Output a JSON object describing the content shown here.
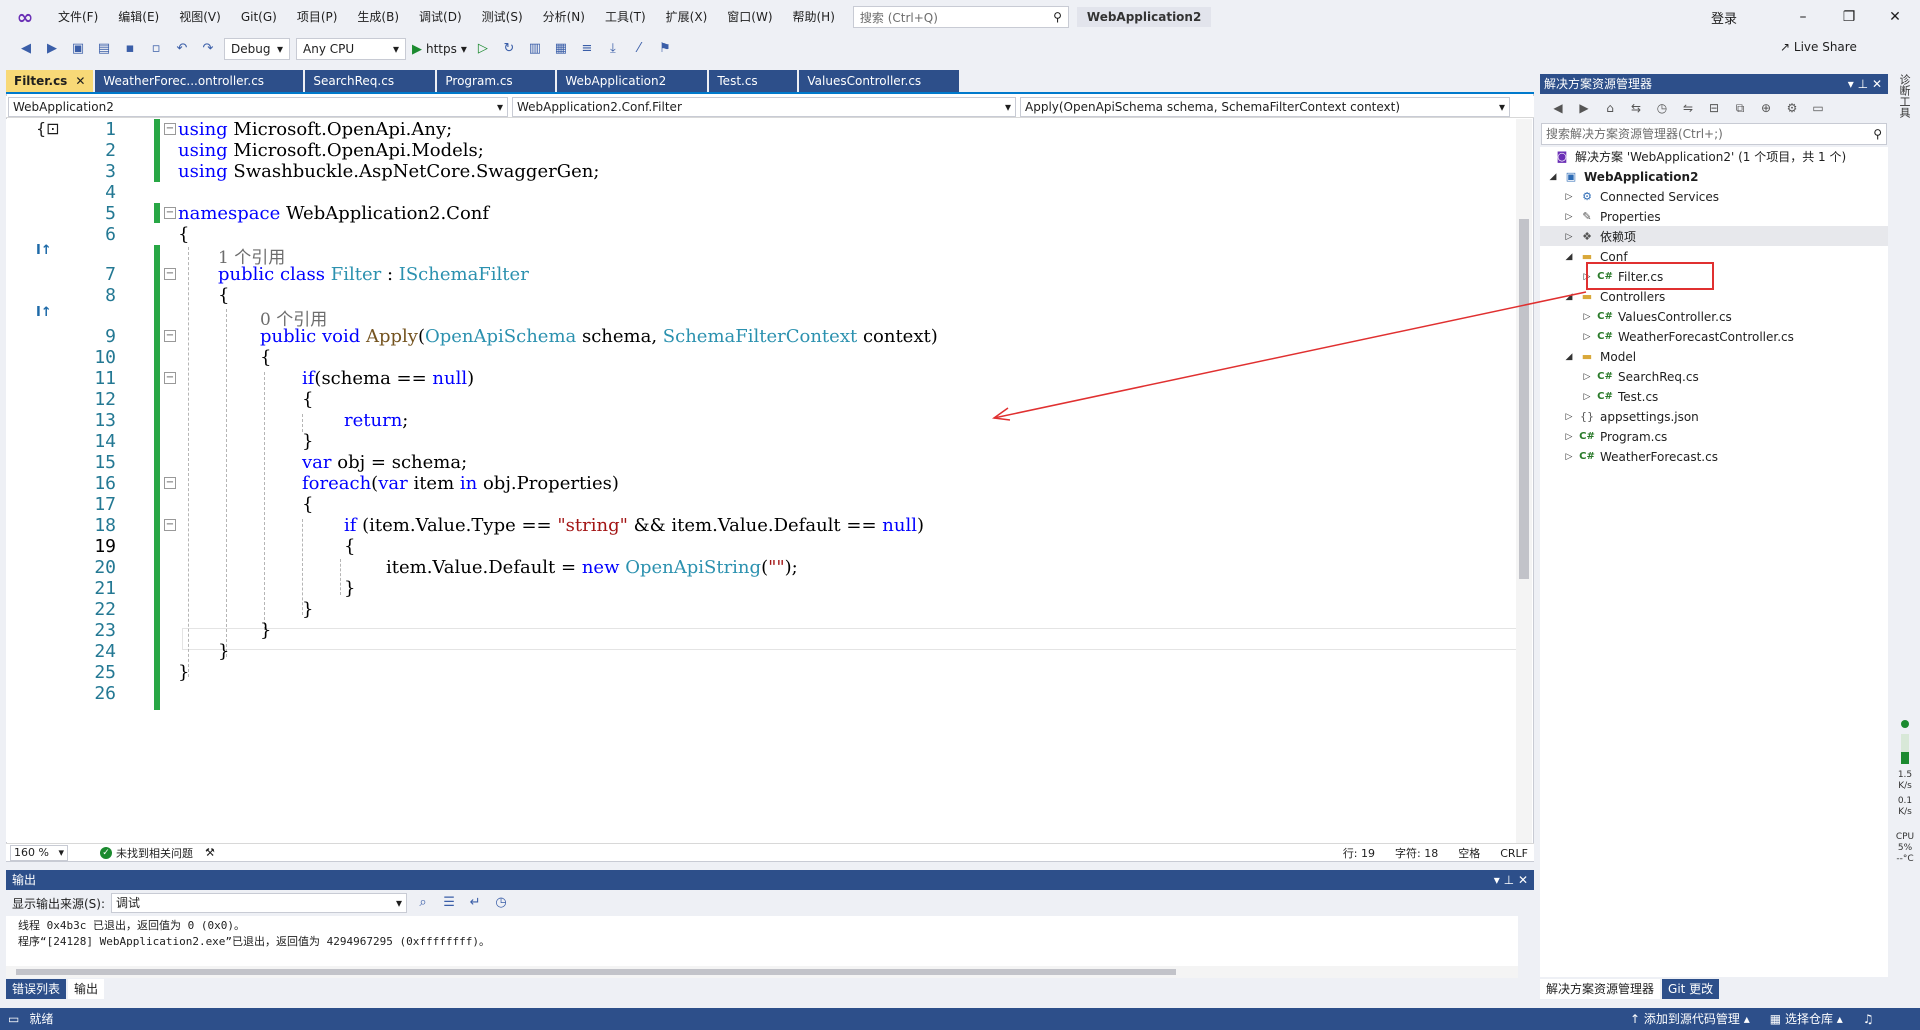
{
  "menu": {
    "items": [
      "文件(F)",
      "编辑(E)",
      "视图(V)",
      "Git(G)",
      "项目(P)",
      "生成(B)",
      "调试(D)",
      "测试(S)",
      "分析(N)",
      "工具(T)",
      "扩展(X)",
      "窗口(W)",
      "帮助(H)"
    ],
    "search_placeholder": "搜索 (Ctrl+Q)",
    "solution_name": "WebApplication2",
    "login": "登录"
  },
  "toolbar": {
    "config": "Debug",
    "platform": "Any CPU",
    "run_label": "https",
    "live_share": "Live Share"
  },
  "tabs": [
    "Filter.cs",
    "WeatherForec...ontroller.cs",
    "SearchReq.cs",
    "Program.cs",
    "WebApplication2",
    "Test.cs",
    "ValuesController.cs"
  ],
  "navbar": {
    "project": "WebApplication2",
    "class": "WebApplication2.Conf.Filter",
    "member": "Apply(OpenApiSchema schema, SchemaFilterContext context)"
  },
  "code": {
    "line_numbers": [
      "1",
      "2",
      "3",
      "4",
      "5",
      "6",
      "7",
      "8",
      "9",
      "10",
      "11",
      "12",
      "13",
      "14",
      "15",
      "16",
      "17",
      "18",
      "19",
      "20",
      "21",
      "22",
      "23",
      "24",
      "25",
      "26"
    ],
    "l1_kw": "using",
    "l1_rest": " Microsoft.OpenApi.Any;",
    "l2_kw": "using",
    "l2_rest": " Microsoft.OpenApi.Models;",
    "l3_kw": "using",
    "l3_rest": " Swashbuckle.AspNetCore.SwaggerGen;",
    "l5_kw": "namespace",
    "l5_rest": " WebApplication2.Conf",
    "ref1": "1 个引用",
    "l7_kw": "public class",
    "l7_name": " Filter",
    "l7_colon": " : ",
    "l7_type": "ISchemaFilter",
    "ref0": "0 个引用",
    "l9_kw": "public void",
    "l9_method": " Apply",
    "l9_p1": "(",
    "l9_t1": "OpenApiSchema",
    "l9_a1": " schema, ",
    "l9_t2": "SchemaFilterContext",
    "l9_a2": " context)",
    "l11_kw": "if",
    "l11_a": "(schema == ",
    "l11_null": "null",
    "l11_b": ")",
    "l13_kw": "return",
    "l13_a": ";",
    "l15_kw": "var",
    "l15_a": " obj = schema;",
    "l16_kw": "foreach",
    "l16_a": "(",
    "l16_kw2": "var",
    "l16_b": " item ",
    "l16_kw3": "in",
    "l16_c": " obj.Properties)",
    "l18_kw": "if",
    "l18_a": " (item.Value.Type == ",
    "l18_str": "\"string\"",
    "l18_b": " && item.Value.Default == ",
    "l18_null": "null",
    "l18_c": ")",
    "l20_a": "item.Value.Default = ",
    "l20_kw": "new",
    "l20_type": " OpenApiString",
    "l20_b": "(",
    "l20_str": "\"\"",
    "l20_c": ");",
    "brace_open": "{",
    "brace_close": "}"
  },
  "editor_status": {
    "zoom": "160 %",
    "issues": "未找到相关问题",
    "line": "行: 19",
    "char": "字符: 18",
    "space": "空格",
    "eol": "CRLF"
  },
  "output": {
    "title": "输出",
    "source_label": "显示输出来源(S):",
    "source_value": "调试",
    "line1": "线程 0x4b3c 已退出，返回值为 0 (0x0)。",
    "line2": "程序“[24128] WebApplication2.exe”已退出，返回值为 4294967295 (0xffffffff)。"
  },
  "bottom_tabs": [
    "错误列表",
    "输出"
  ],
  "solution_explorer": {
    "title": "解决方案资源管理器",
    "search_placeholder": "搜索解决方案资源管理器(Ctrl+;)",
    "solution": "解决方案 'WebApplication2' (1 个项目，共 1 个)",
    "project": "WebApplication2",
    "connected": "Connected Services",
    "properties": "Properties",
    "deps": "依赖项",
    "conf": "Conf",
    "filter": "Filter.cs",
    "controllers": "Controllers",
    "values_ctrl": "ValuesController.cs",
    "weather_ctrl": "WeatherForecastController.cs",
    "model": "Model",
    "searchreq": "SearchReq.cs",
    "test": "Test.cs",
    "appsettings": "appsettings.json",
    "program": "Program.cs",
    "weather": "WeatherForecast.cs",
    "tabs": [
      "解决方案资源管理器",
      "Git 更改"
    ]
  },
  "right_strip": {
    "vtab": "诊断工具",
    "net_up": "1.5",
    "net_up_unit": "K/s",
    "net_down": "0.1",
    "net_down_unit": "K/s",
    "cpu_label": "CPU",
    "cpu_value": "5%",
    "temp": "--°C"
  },
  "statusbar": {
    "ready": "就绪",
    "add_source": "添加到源代码管理",
    "select_repo": "选择仓库"
  },
  "colors": {
    "accent": "#2d4f8a",
    "active_tab": "#f8d977",
    "highlight": "#e03030"
  }
}
